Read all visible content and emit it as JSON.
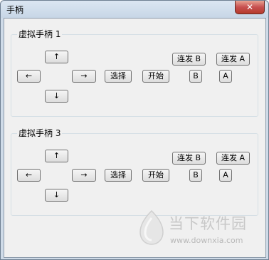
{
  "window": {
    "title": "手柄",
    "close_glyph": "✕"
  },
  "groups": [
    {
      "title": "虚拟手柄 1",
      "up": "↑",
      "left": "←",
      "right": "→",
      "down": "↓",
      "select": "选择",
      "start": "开始",
      "turbo_b": "连发 B",
      "turbo_a": "连发 A",
      "b": "B",
      "a": "A"
    },
    {
      "title": "虚拟手柄 3",
      "up": "↑",
      "left": "←",
      "right": "→",
      "down": "↓",
      "select": "选择",
      "start": "开始",
      "turbo_b": "连发 B",
      "turbo_a": "连发 A",
      "b": "B",
      "a": "A"
    }
  ],
  "watermark": {
    "text": "当下软件园",
    "url": "www.downxia.com"
  }
}
